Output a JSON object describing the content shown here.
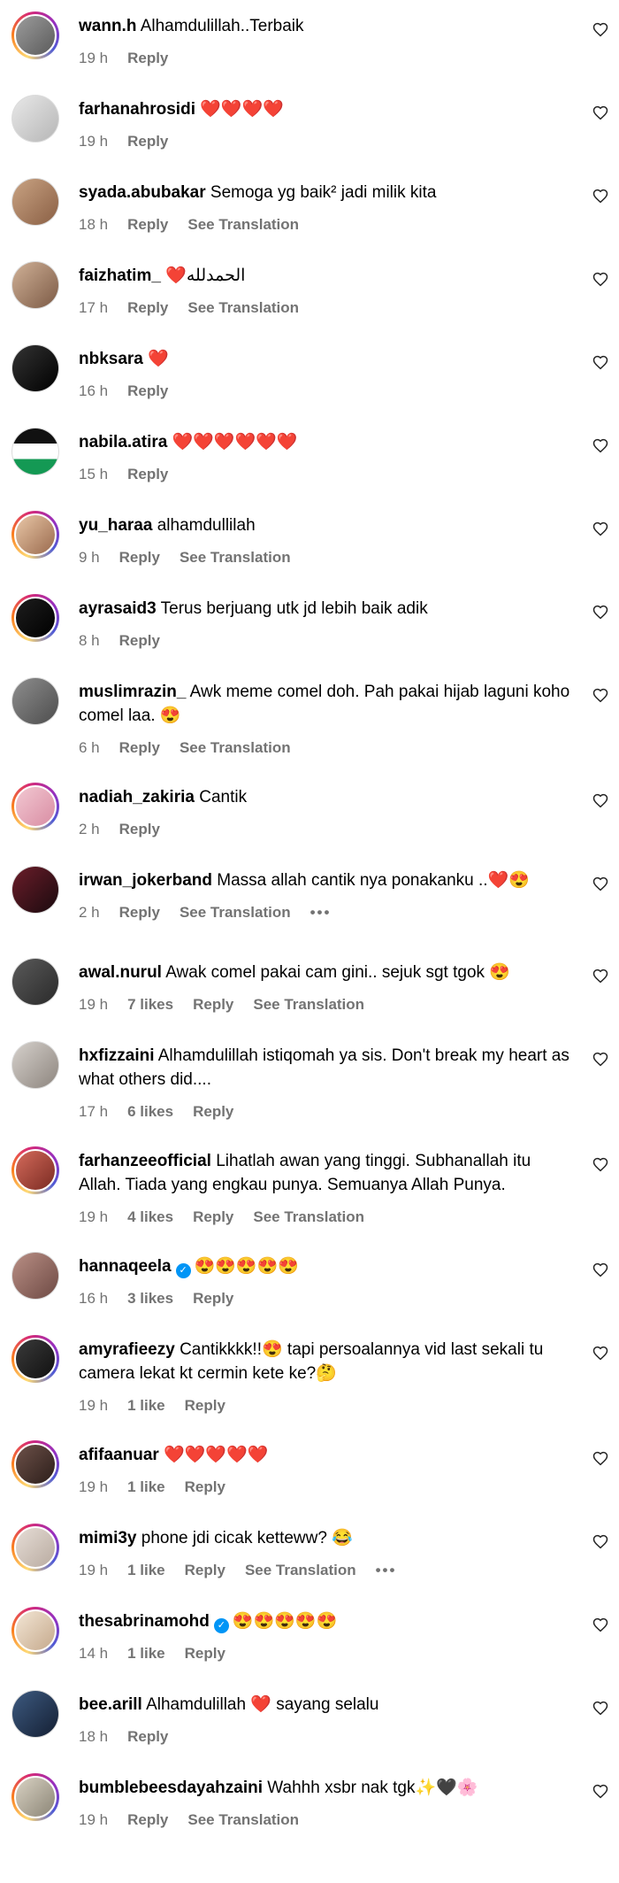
{
  "actions": {
    "reply": "Reply",
    "see_translation": "See Translation",
    "more": "•••"
  },
  "comments": [
    {
      "username": "wann.h",
      "text": "Alhamdulillah..Terbaik",
      "time": "19 h",
      "likes": "",
      "verified": false,
      "translation": false,
      "more": false,
      "avatar": {
        "story": true,
        "bg": "linear-gradient(135deg,#9c9c9c,#5b5b5b)"
      }
    },
    {
      "username": "farhanahrosidi",
      "text": "❤️❤️❤️❤️",
      "time": "19 h",
      "likes": "",
      "verified": false,
      "translation": false,
      "more": false,
      "avatar": {
        "story": false,
        "bg": "linear-gradient(135deg,#e8e8e8,#b6b6b6)"
      }
    },
    {
      "username": "syada.abubakar",
      "text": "Semoga yg baik² jadi milik kita",
      "time": "18 h",
      "likes": "",
      "verified": false,
      "translation": true,
      "more": false,
      "avatar": {
        "story": false,
        "bg": "linear-gradient(135deg,#c9a383,#8a5f44)"
      }
    },
    {
      "username": "faizhatim_",
      "text": "❤️الحمدلله",
      "time": "17 h",
      "likes": "",
      "verified": false,
      "translation": true,
      "more": false,
      "avatar": {
        "story": false,
        "bg": "linear-gradient(135deg,#d0b197,#7c5a45)"
      }
    },
    {
      "username": "nbksara",
      "text": "❤️",
      "time": "16 h",
      "likes": "",
      "verified": false,
      "translation": false,
      "more": false,
      "avatar": {
        "story": false,
        "bg": "linear-gradient(135deg,#333333,#000000)"
      }
    },
    {
      "username": "nabila.atira",
      "text": "❤️❤️❤️❤️❤️❤️",
      "time": "15 h",
      "likes": "",
      "verified": false,
      "translation": false,
      "more": false,
      "avatar": {
        "story": false,
        "bg": "linear-gradient(180deg,#111111 0 33%,#ffffff 33% 66%,#149954 66%)"
      }
    },
    {
      "username": "yu_haraa",
      "text": "alhamdullilah",
      "time": "9 h",
      "likes": "",
      "verified": false,
      "translation": true,
      "more": false,
      "avatar": {
        "story": true,
        "bg": "linear-gradient(135deg,#e9c7a7,#9a6a4d)"
      }
    },
    {
      "username": "ayrasaid3",
      "text": "Terus berjuang utk jd lebih baik adik",
      "time": "8 h",
      "likes": "",
      "verified": false,
      "translation": false,
      "more": false,
      "avatar": {
        "story": true,
        "bg": "linear-gradient(135deg,#1d1d1d,#000000)"
      }
    },
    {
      "username": "muslimrazin_",
      "text": "Awk meme comel doh. Pah pakai hijab laguni koho comel laa. 😍",
      "time": "6 h",
      "likes": "",
      "verified": false,
      "translation": true,
      "more": false,
      "avatar": {
        "story": false,
        "bg": "linear-gradient(135deg,#8e8e8e,#4d4d4d)"
      }
    },
    {
      "username": "nadiah_zakiria",
      "text": "Cantik",
      "time": "2 h",
      "likes": "",
      "verified": false,
      "translation": false,
      "more": false,
      "avatar": {
        "story": true,
        "bg": "linear-gradient(135deg,#f2c8d2,#d98da3)"
      }
    },
    {
      "username": "irwan_jokerband",
      "text": "Massa allah cantik nya ponakanku ..❤️😍",
      "time": "2 h",
      "likes": "",
      "verified": false,
      "translation": true,
      "more": true,
      "avatar": {
        "story": false,
        "bg": "linear-gradient(135deg,#6b1d2a,#1a0a0e)"
      }
    },
    {
      "username": "awal.nurul",
      "text": "Awak comel pakai cam gini.. sejuk sgt tgok 😍",
      "time": "19 h",
      "likes": "7 likes",
      "verified": false,
      "translation": true,
      "more": false,
      "avatar": {
        "story": false,
        "bg": "linear-gradient(135deg,#5a5a5a,#2a2a2a)"
      }
    },
    {
      "username": "hxfizzaini",
      "text": "Alhamdulillah istiqomah ya sis. Don't break my heart as what others did....",
      "time": "17 h",
      "likes": "6 likes",
      "verified": false,
      "translation": false,
      "more": false,
      "avatar": {
        "story": false,
        "bg": "linear-gradient(135deg,#d6d1cc,#8d857e)"
      }
    },
    {
      "username": "farhanzeeofficial",
      "text": "Lihatlah awan yang tinggi. Subhanallah itu Allah. Tiada yang engkau punya. Semuanya Allah Punya.",
      "time": "19 h",
      "likes": "4 likes",
      "verified": false,
      "translation": true,
      "more": false,
      "avatar": {
        "story": true,
        "bg": "linear-gradient(135deg,#d46a5b,#7a2b22)"
      }
    },
    {
      "username": "hannaqeela",
      "text": "😍😍😍😍😍",
      "time": "16 h",
      "likes": "3 likes",
      "verified": true,
      "translation": false,
      "more": false,
      "avatar": {
        "story": false,
        "bg": "linear-gradient(135deg,#b98f85,#6e4a44)"
      }
    },
    {
      "username": "amyrafieezy",
      "text": "Cantikkkk!!😍 tapi persoalannya vid last sekali tu camera lekat kt cermin kete ke?🤔",
      "time": "19 h",
      "likes": "1 like",
      "verified": false,
      "translation": false,
      "more": false,
      "avatar": {
        "story": true,
        "bg": "linear-gradient(135deg,#3a3a3a,#111111)"
      }
    },
    {
      "username": "afifaanuar",
      "text": "❤️❤️❤️❤️❤️",
      "time": "19 h",
      "likes": "1 like",
      "verified": false,
      "translation": false,
      "more": false,
      "avatar": {
        "story": true,
        "bg": "linear-gradient(135deg,#6d5149,#2c1e1a)"
      }
    },
    {
      "username": "mimi3y",
      "text": "phone jdi cicak ketteww? 😂",
      "time": "19 h",
      "likes": "1 like",
      "verified": false,
      "translation": true,
      "more": true,
      "avatar": {
        "story": true,
        "bg": "linear-gradient(135deg,#e6ddd6,#b9aba0)"
      }
    },
    {
      "username": "thesabrinamohd",
      "text": "😍😍😍😍😍",
      "time": "14 h",
      "likes": "1 like",
      "verified": true,
      "translation": false,
      "more": false,
      "avatar": {
        "story": true,
        "bg": "linear-gradient(135deg,#f3e6d5,#c5a98c)"
      }
    },
    {
      "username": "bee.arill",
      "text": "Alhamdulillah ❤️ sayang selalu",
      "time": "18 h",
      "likes": "",
      "verified": false,
      "translation": false,
      "more": false,
      "avatar": {
        "story": false,
        "bg": "linear-gradient(135deg,#3d5a80,#141f33)"
      }
    },
    {
      "username": "bumblebeesdayahzaini",
      "text": "Wahhh xsbr nak tgk✨🖤🌸",
      "time": "19 h",
      "likes": "",
      "verified": false,
      "translation": true,
      "more": false,
      "avatar": {
        "story": true,
        "bg": "linear-gradient(135deg,#d9d2c3,#8b8576)"
      }
    }
  ]
}
